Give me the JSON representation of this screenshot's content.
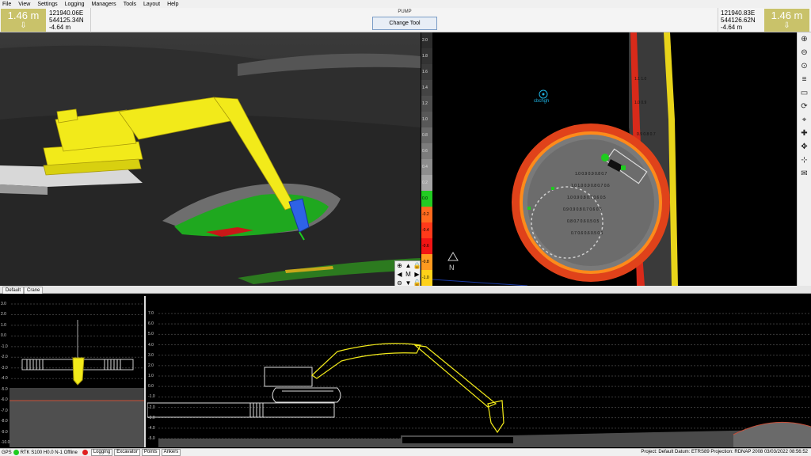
{
  "menu": [
    "File",
    "View",
    "Settings",
    "Logging",
    "Managers",
    "Tools",
    "Layout",
    "Help"
  ],
  "left_height": {
    "value": "1.46 m",
    "arrow": "⇩"
  },
  "left_coords": {
    "e": "121940.06E",
    "n": "544125.34N",
    "h": "-4.64 m"
  },
  "tool": {
    "label": "PUMP",
    "button": "Change Tool"
  },
  "right_coords": {
    "e": "121940.83E",
    "n": "544126.62N",
    "h": "-4.64 m"
  },
  "right_height": {
    "value": "1.46 m",
    "arrow": "⇩"
  },
  "color_scale": {
    "labels": [
      "2.0",
      "1.8",
      "1.6",
      "1.4",
      "1.2",
      "1.0",
      "0.8",
      "0.6",
      "0.4",
      "0.2",
      "0.0",
      "-0.2",
      "-0.4",
      "-0.6",
      "-0.8",
      "-1.0"
    ],
    "colors": [
      "#2c2c2c",
      "#333",
      "#3a3a3a",
      "#444",
      "#4e4e4e",
      "#585858",
      "#6a6a6a",
      "#7c7c7c",
      "#8e8e8e",
      "#a5a5a5",
      "#22cc22",
      "#ff6a1e",
      "#ff3a1a",
      "#f21414",
      "#ff9a1f",
      "#ffd21a"
    ]
  },
  "plan_marker_label": "cbchgh",
  "nav_pad": [
    "⊕",
    "▲",
    "🔒",
    "◀",
    "M",
    "▶",
    "⊖",
    "▼",
    "🔓"
  ],
  "right_tools": [
    "zoom-in-icon",
    "zoom-out-icon",
    "zoom-fit-icon",
    "layers-icon",
    "grid-icon",
    "rotate-icon",
    "target-icon",
    "center-icon",
    "move-icon",
    "pan-icon",
    "envelope-icon"
  ],
  "right_tool_glyphs": [
    "⊕",
    "⊖",
    "⊙",
    "≡",
    "▭",
    "⟳",
    "⌖",
    "✚",
    "✥",
    "⊹",
    "✉"
  ],
  "tabs": [
    "Default",
    "Crane"
  ],
  "side_left_axis": [
    "3.0",
    "2.0",
    "1.0",
    "0.0",
    "-1.0",
    "-2.0",
    "-3.0",
    "-4.0",
    "-5.0",
    "-6.0",
    "-7.0",
    "-8.0",
    "-9.0",
    "-10.0"
  ],
  "side_main_axis": [
    "7.0",
    "6.0",
    "5.0",
    "4.0",
    "3.0",
    "2.0",
    "1.0",
    "0.0",
    "-1.0",
    "-2.0",
    "-3.0",
    "-4.0",
    "-5.0"
  ],
  "status": {
    "gps_label": "GPS",
    "rtk": "RTK S100 H0.0 N-1 Offline",
    "tabs": [
      "Logging",
      "Excavator",
      "Points",
      "Ankers"
    ],
    "right": "Project: Default  Datum: ETRS89  Projection: RDNAP 2008  03/03/2022 08:56:52"
  },
  "colors": {
    "accent": "#c9c26a",
    "machine": "#f2ea1a",
    "design_green": "#1fc41f",
    "design_red": "#e3261a"
  }
}
